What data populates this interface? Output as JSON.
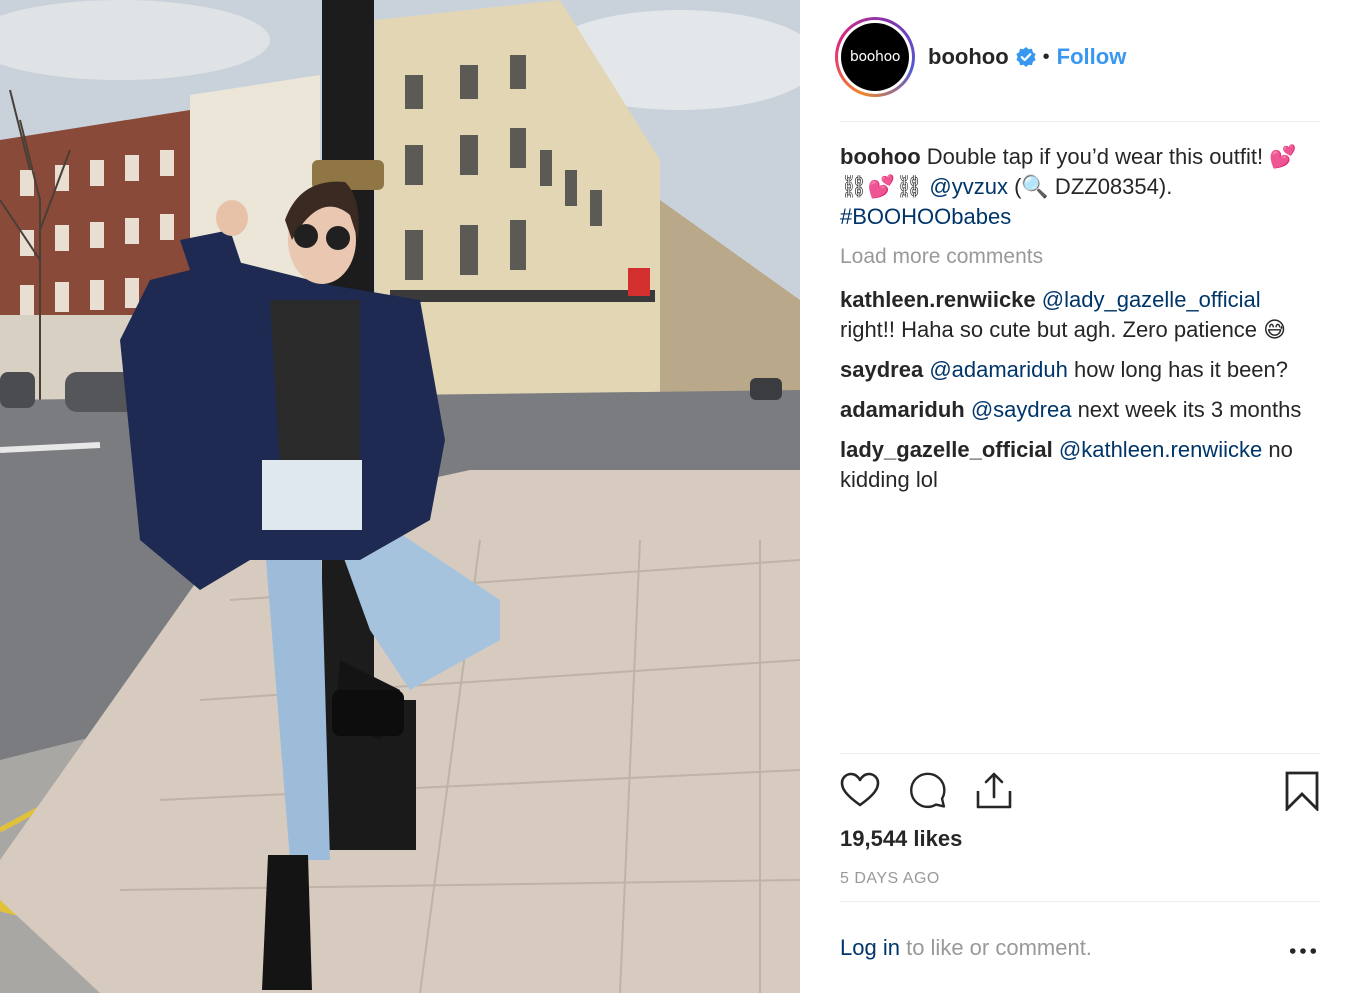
{
  "post": {
    "avatar_text": "boohoo",
    "username": "boohoo",
    "separator": "•",
    "follow_label": "Follow"
  },
  "caption": {
    "username": "boohoo",
    "text_start": "Double tap if you’d wear this outfit! 💕",
    "text_mid": "⛓💕⛓",
    "mention": "@yvzux",
    "text_after_mention": "(🔍 DZZ08354).",
    "hashtag": "#BOOHOObabes"
  },
  "load_more_label": "Load more comments",
  "comments": [
    {
      "username": "kathleen.renwiicke",
      "mention": "@lady_gazelle_official",
      "text": "right!! Haha so cute but agh. Zero patience 😅"
    },
    {
      "username": "saydrea",
      "mention": "@adamariduh",
      "text": "how long has it been?"
    },
    {
      "username": "adamariduh",
      "mention": "@saydrea",
      "text": "next week its 3 months"
    },
    {
      "username": "lady_gazelle_official",
      "mention": "@kathleen.renwiicke",
      "text": "no kidding lol"
    }
  ],
  "likes": "19,544 likes",
  "timestamp": "5 DAYS AGO",
  "login": {
    "link": "Log in",
    "text": "to like or comment."
  },
  "colors": {
    "link_blue": "#3897f0",
    "mention_navy": "#003569",
    "muted_gray": "#999999",
    "verified_blue": "#3897f0"
  }
}
